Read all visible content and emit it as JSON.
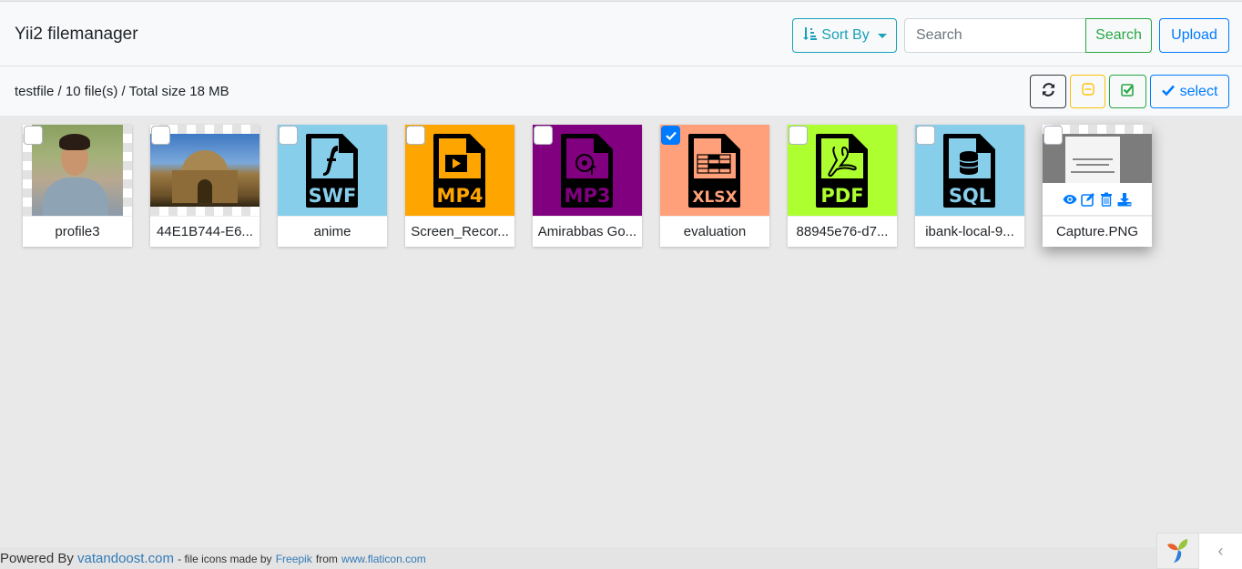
{
  "header": {
    "title": "Yii2 filemanager",
    "sort_label": "Sort By",
    "search_placeholder": "Search",
    "search_value": "",
    "search_button": "Search",
    "upload_button": "Upload"
  },
  "toolbar": {
    "path_info": "testfile / 10 file(s) / Total size 18 MB",
    "select_label": "select"
  },
  "colors": {
    "primary": "#007bff",
    "info": "#17a2b8",
    "success": "#28a745",
    "warning": "#ffc107",
    "dark": "#343a40"
  },
  "files": [
    {
      "name": "profile3",
      "kind": "image",
      "checked": false
    },
    {
      "name": "44E1B744-E6...",
      "kind": "image",
      "checked": false
    },
    {
      "name": "anime",
      "kind": "swf-file-icon",
      "ext": "SWF",
      "color": "#87ceeb",
      "checked": false
    },
    {
      "name": "Screen_Recor...",
      "kind": "mp4-file-icon",
      "ext": "MP4",
      "color": "#ffa500",
      "checked": false
    },
    {
      "name": "Amirabbas Go...",
      "kind": "mp3-file-icon",
      "ext": "MP3",
      "color": "#800080",
      "checked": false
    },
    {
      "name": "evaluation",
      "kind": "xlsx-file-icon",
      "ext": "XLSX",
      "color": "#ffa07a",
      "checked": true
    },
    {
      "name": "88945e76-d7...",
      "kind": "pdf-file-icon",
      "ext": "PDF",
      "color": "#adff2f",
      "checked": false
    },
    {
      "name": "ibank-local-9...",
      "kind": "sql-file-icon",
      "ext": "SQL",
      "color": "#87ceeb",
      "checked": false
    },
    {
      "name": "Capture.PNG",
      "kind": "image",
      "checked": false,
      "hovered": true,
      "actions": [
        "view",
        "edit",
        "delete",
        "download"
      ]
    }
  ],
  "footer": {
    "powered_by": "Powered By",
    "site_link": "vatandoost.com",
    "dash": " - ",
    "icons_credit": "file icons made by",
    "author_link": "Freepik",
    "from": "from",
    "source_link": "www.flaticon.com"
  }
}
